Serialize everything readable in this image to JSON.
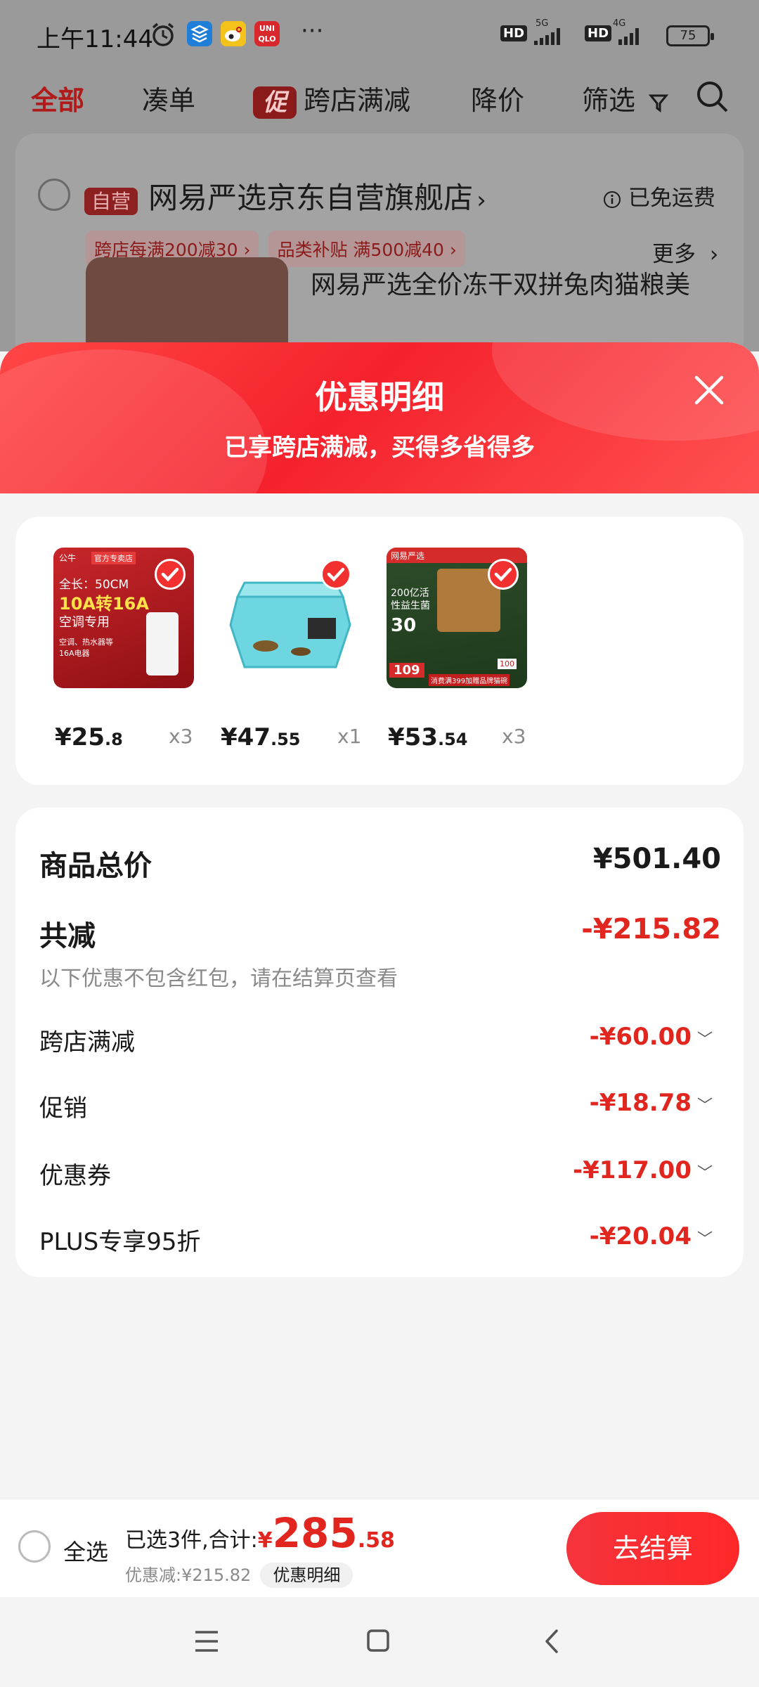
{
  "status_bar": {
    "time": "上午11:44",
    "net1": "5G",
    "net2": "4G",
    "hd": "HD",
    "app_labels": [
      "UNI QLO"
    ],
    "battery": "75"
  },
  "top_tabs": {
    "all": "全部",
    "bundle": "凑单",
    "promo_badge": "促",
    "cross_store": "跨店满减",
    "price_drop": "降价",
    "filter": "筛选"
  },
  "store": {
    "self_tag": "自营",
    "name": "网易严选京东自营旗舰店",
    "shipping": "已免运费",
    "chips": [
      "跨店每满200减30 ›",
      "品类补贴 满500减40 ›"
    ],
    "more": "更多",
    "product_title": "网易严选全价冻干双拼兔肉猫粮美"
  },
  "sheet": {
    "title": "优惠明细",
    "subtitle": "已享跨店满减，买得多省得多"
  },
  "products": [
    {
      "price_main": "¥25",
      "price_dec": ".8",
      "qty": "x3",
      "img_text": [
        "公牛",
        "官方专卖店",
        "全长：50CM",
        "10A转16A",
        "空调专用",
        "空调、热水器等",
        "16A电器"
      ]
    },
    {
      "price_main": "¥47",
      "price_dec": ".55",
      "qty": "x1",
      "img_text": []
    },
    {
      "price_main": "¥53",
      "price_dec": ".54",
      "qty": "x3",
      "img_text": [
        "网易严选",
        "200亿活",
        "性益生菌",
        "30",
        "109",
        "消费满399加赠品牌猫碗",
        "100"
      ]
    }
  ],
  "summary": {
    "total_label": "商品总价",
    "total_value": "¥501.40",
    "reduce_label": "共减",
    "reduce_value": "-¥215.82",
    "note": "以下优惠不包含红包，请在结算页查看",
    "rows": [
      {
        "label": "跨店满减",
        "value": "-¥60.00"
      },
      {
        "label": "促销",
        "value": "-¥18.78"
      },
      {
        "label": "优惠券",
        "value": "-¥117.00"
      },
      {
        "label": "PLUS专享95折",
        "value": "-¥20.04"
      }
    ]
  },
  "bottom": {
    "select_all": "全选",
    "selected_text": "已选3件,合计:",
    "currency": "¥",
    "total_int": "285",
    "total_dec": ".58",
    "discount_text": "优惠减:¥215.82",
    "detail_button": "优惠明细",
    "checkout": "去结算"
  },
  "colors": {
    "accent": "#f5222d",
    "price_red": "#e0261f",
    "sheet_bg": "#f4f4f4"
  },
  "icons": [
    "alarm-icon",
    "stack-app-icon",
    "weibo-icon",
    "uniqlo-icon",
    "more-dots-icon",
    "filter-funnel-icon",
    "search-icon",
    "info-icon",
    "close-icon",
    "check-icon",
    "menu-icon",
    "home-square-icon",
    "back-icon"
  ]
}
